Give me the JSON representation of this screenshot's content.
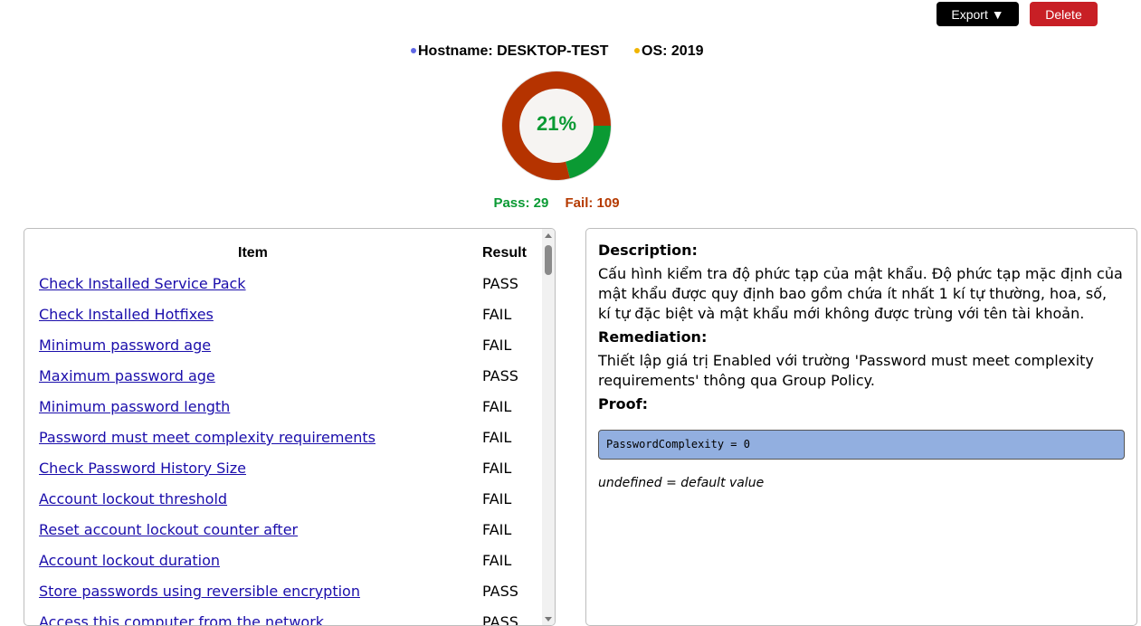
{
  "toolbar": {
    "export_label": "Export ▼",
    "delete_label": "Delete"
  },
  "host": {
    "hostname": "Hostname: DESKTOP-TEST",
    "os": "OS: 2019",
    "hostname_dot_color": "#6068e6",
    "os_dot_color": "#f0b400"
  },
  "summary": {
    "percent_label": "21%",
    "pass_label": "Pass: 29",
    "fail_label": "Fail: 109",
    "pass_count": 29,
    "fail_count": 109,
    "pass_color": "#0a9a33",
    "fail_color": "#b53300"
  },
  "table": {
    "headers": {
      "item": "Item",
      "result": "Result"
    },
    "rows": [
      {
        "item": "Check Installed Service Pack",
        "result": "PASS"
      },
      {
        "item": "Check Installed Hotfixes",
        "result": "FAIL"
      },
      {
        "item": "Minimum password age",
        "result": "FAIL"
      },
      {
        "item": "Maximum password age",
        "result": "PASS"
      },
      {
        "item": "Minimum password length",
        "result": "FAIL"
      },
      {
        "item": "Password must meet complexity requirements",
        "result": "FAIL"
      },
      {
        "item": "Check Password History Size",
        "result": "FAIL"
      },
      {
        "item": "Account lockout threshold",
        "result": "FAIL"
      },
      {
        "item": "Reset account lockout counter after",
        "result": "FAIL"
      },
      {
        "item": "Account lockout duration",
        "result": "FAIL"
      },
      {
        "item": "Store passwords using reversible encryption",
        "result": "PASS"
      },
      {
        "item": "Access this computer from the network",
        "result": "PASS"
      }
    ]
  },
  "detail": {
    "description_title": "Description:",
    "description_text": "Cấu hình kiểm tra độ phức tạp của mật khẩu. Độ phức tạp mặc định của mật khẩu được quy định bao gồm chứa ít nhất 1 kí tự thường, hoa, số, kí tự đặc biệt và mật khẩu mới không được trùng với tên tài khoản.",
    "remediation_title": "Remediation:",
    "remediation_text": "Thiết lập giá trị Enabled với trường 'Password must meet complexity requirements' thông qua Group Policy.",
    "proof_title": "Proof:",
    "proof_value": "PasswordComplexity = 0",
    "proof_note": "undefined = default value"
  }
}
